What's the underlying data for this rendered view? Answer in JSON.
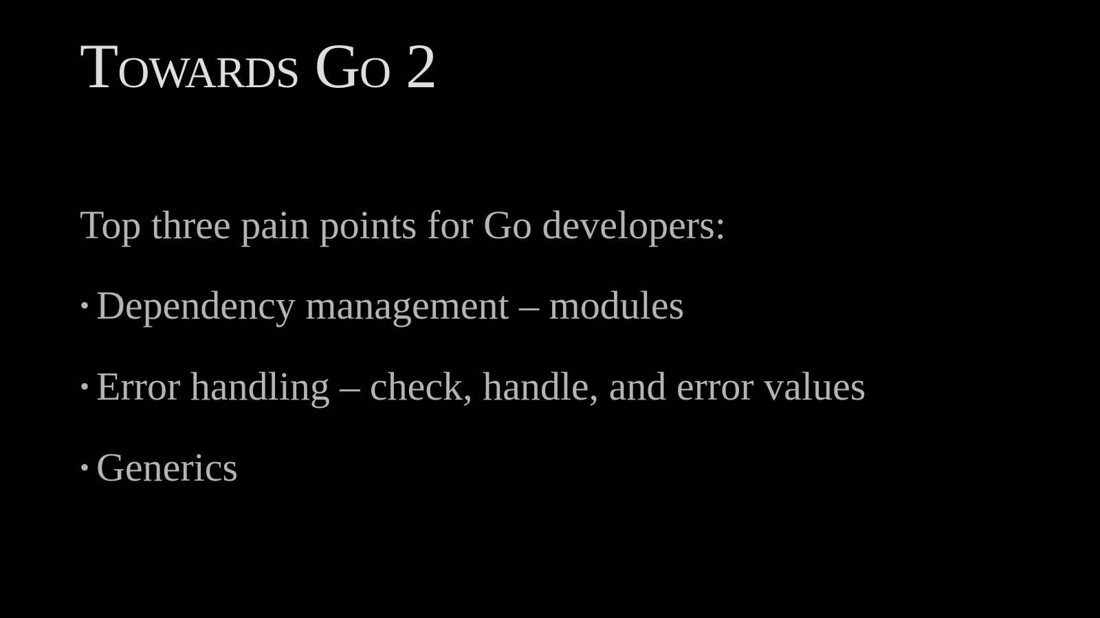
{
  "slide": {
    "title": "Towards Go 2",
    "intro": "Top three pain points for Go developers:",
    "bullets": [
      {
        "text": "Dependency management – modules"
      },
      {
        "text": "Error handling – check, handle, and error values"
      },
      {
        "text": "Generics"
      }
    ],
    "colors": {
      "background": "#000000",
      "title": "#dedede",
      "body": "#b4b4b4"
    },
    "bullet_glyph": "•"
  }
}
